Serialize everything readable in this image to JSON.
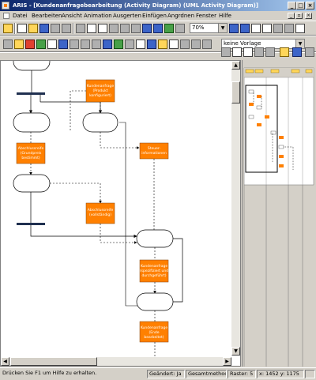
{
  "window": {
    "title": "ARIS - [Kundenanfragebearbeitung (Activity Diagram) (UML Activity Diagram)]"
  },
  "menu": [
    "Datei",
    "Bearbeiten",
    "Ansicht",
    "Animation",
    "Ausgerten",
    "Einfügen",
    "Angrdnen",
    "Fenster",
    "Hilfe"
  ],
  "toolbar": {
    "zoom": "70%",
    "template": "keine Vorlage"
  },
  "diagram": {
    "labels": {
      "n1": [
        "Kundenanfrage",
        "(Produkt",
        "konfiguriert)"
      ],
      "n2": [
        "Abschlussreife",
        "(Grundpreis",
        "bestimmt)"
      ],
      "n3": [
        "Steuer-",
        "informationen"
      ],
      "n4": [
        "Abschlussreife",
        "(vollständig)"
      ],
      "n5": [
        "Kundenanfrage",
        "(spezifiziert und",
        "durchgeführt)"
      ],
      "n6": [
        "Kundenanfrage",
        "(Ende",
        "bearbeitet)"
      ]
    }
  },
  "status": {
    "help": "Drücken Sie F1 um Hilfe zu erhalten.",
    "changed": "Geändert: Ja",
    "method": "Gesamtmethode",
    "grid": "Raster: 5",
    "coords": "x: 1452 y: 1175"
  },
  "colors": {
    "orange": "#ff8000",
    "titlebar": "#0a246a",
    "chrome": "#d4d0c8"
  }
}
